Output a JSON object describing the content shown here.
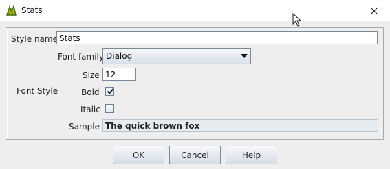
{
  "window": {
    "title": "Stats"
  },
  "form": {
    "style_name_label": "Style name",
    "style_name_value": "Stats",
    "font_family_label": "Font family",
    "font_family_value": "Dialog",
    "size_label": "Size",
    "size_value": "12",
    "font_style_label": "Font Style",
    "bold_label": "Bold",
    "bold_checked": true,
    "italic_label": "Italic",
    "italic_checked": false,
    "sample_label": "Sample",
    "sample_text": "The quick brown fox"
  },
  "buttons": {
    "ok": "OK",
    "cancel": "Cancel",
    "help": "Help"
  },
  "icons": {
    "app": "app-icon",
    "close": "close-icon",
    "dropdown": "chevron-down-icon",
    "cursor": "cursor-icon",
    "check": "check-icon"
  }
}
